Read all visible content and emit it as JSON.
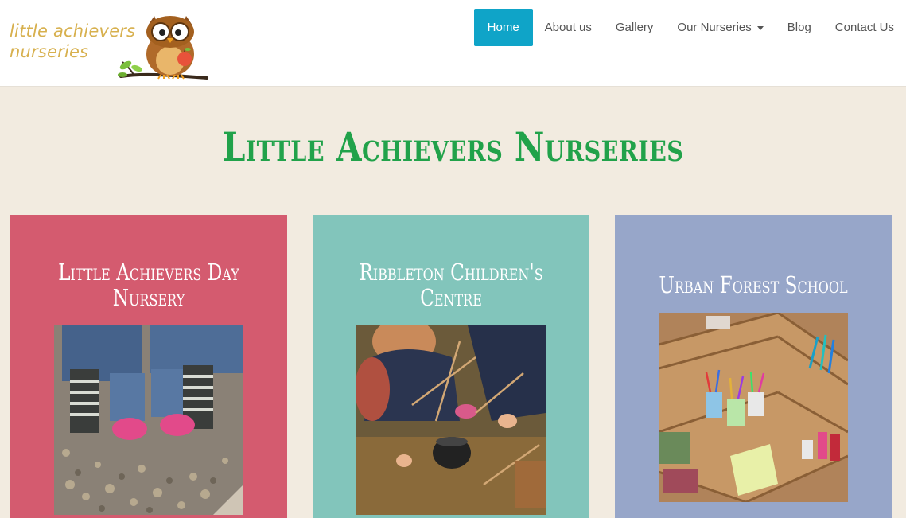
{
  "logo": {
    "line1": "little achievers",
    "line2": "nurseries",
    "icon": "owl-on-branch-icon"
  },
  "nav": {
    "items": [
      {
        "label": "Home",
        "active": true
      },
      {
        "label": "About us"
      },
      {
        "label": "Gallery"
      },
      {
        "label": "Our Nurseries",
        "dropdown": true
      },
      {
        "label": "Blog"
      },
      {
        "label": "Contact Us"
      }
    ],
    "active_color": "#0fa4c8"
  },
  "main": {
    "title": "Little Achievers Nurseries",
    "title_color": "#21a24a",
    "cards": [
      {
        "title": "Little Achievers Day Nursery",
        "color": "#d45b6f"
      },
      {
        "title": "Ribbleton Children's Centre",
        "color": "#82c5bb"
      },
      {
        "title": "Urban Forest School",
        "color": "#97a6c9"
      }
    ]
  }
}
